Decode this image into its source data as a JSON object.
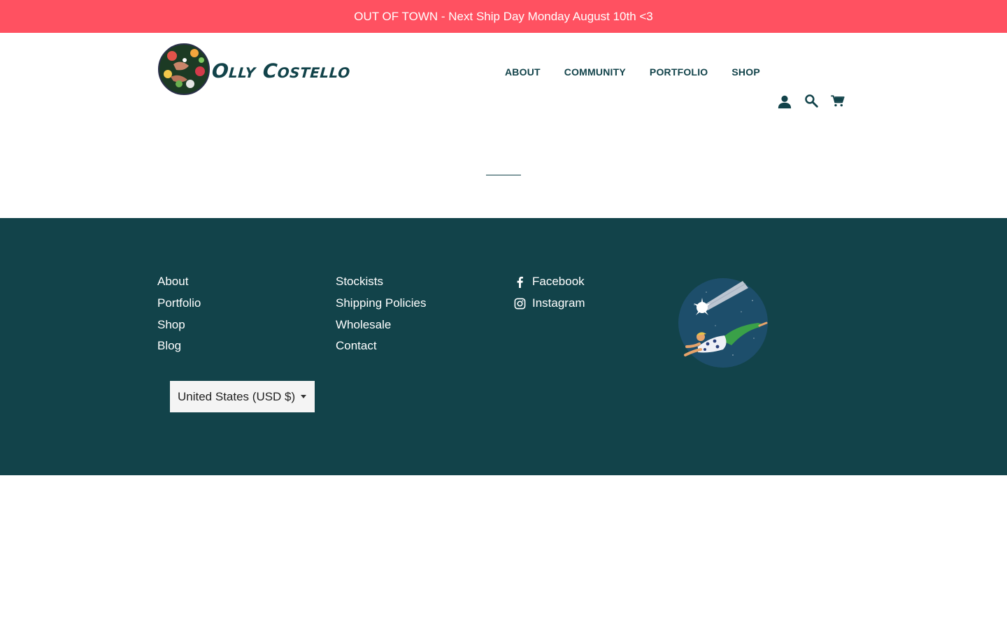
{
  "colors": {
    "announcement_bg": "#ff5161",
    "accent": "#12434a",
    "footer_bg": "#12434a",
    "footer_text": "#ffffff"
  },
  "announcement": {
    "text": "OUT OF TOWN - Next Ship Day Monday August 10th <3"
  },
  "header": {
    "logo_text": "Olly Costello",
    "nav": [
      {
        "label": "About"
      },
      {
        "label": "Community"
      },
      {
        "label": "Portfolio"
      },
      {
        "label": "Shop"
      }
    ],
    "icons": [
      "account-icon",
      "search-icon",
      "cart-icon"
    ]
  },
  "footer": {
    "column1": [
      "About",
      "Portfolio",
      "Shop",
      "Blog"
    ],
    "column2": [
      "Stockists",
      "Shipping Policies",
      "Wholesale",
      "Contact"
    ],
    "social": [
      {
        "label": "Facebook",
        "icon": "facebook-icon"
      },
      {
        "label": "Instagram",
        "icon": "instagram-icon"
      }
    ],
    "currency_selected": "United States (USD $)"
  }
}
